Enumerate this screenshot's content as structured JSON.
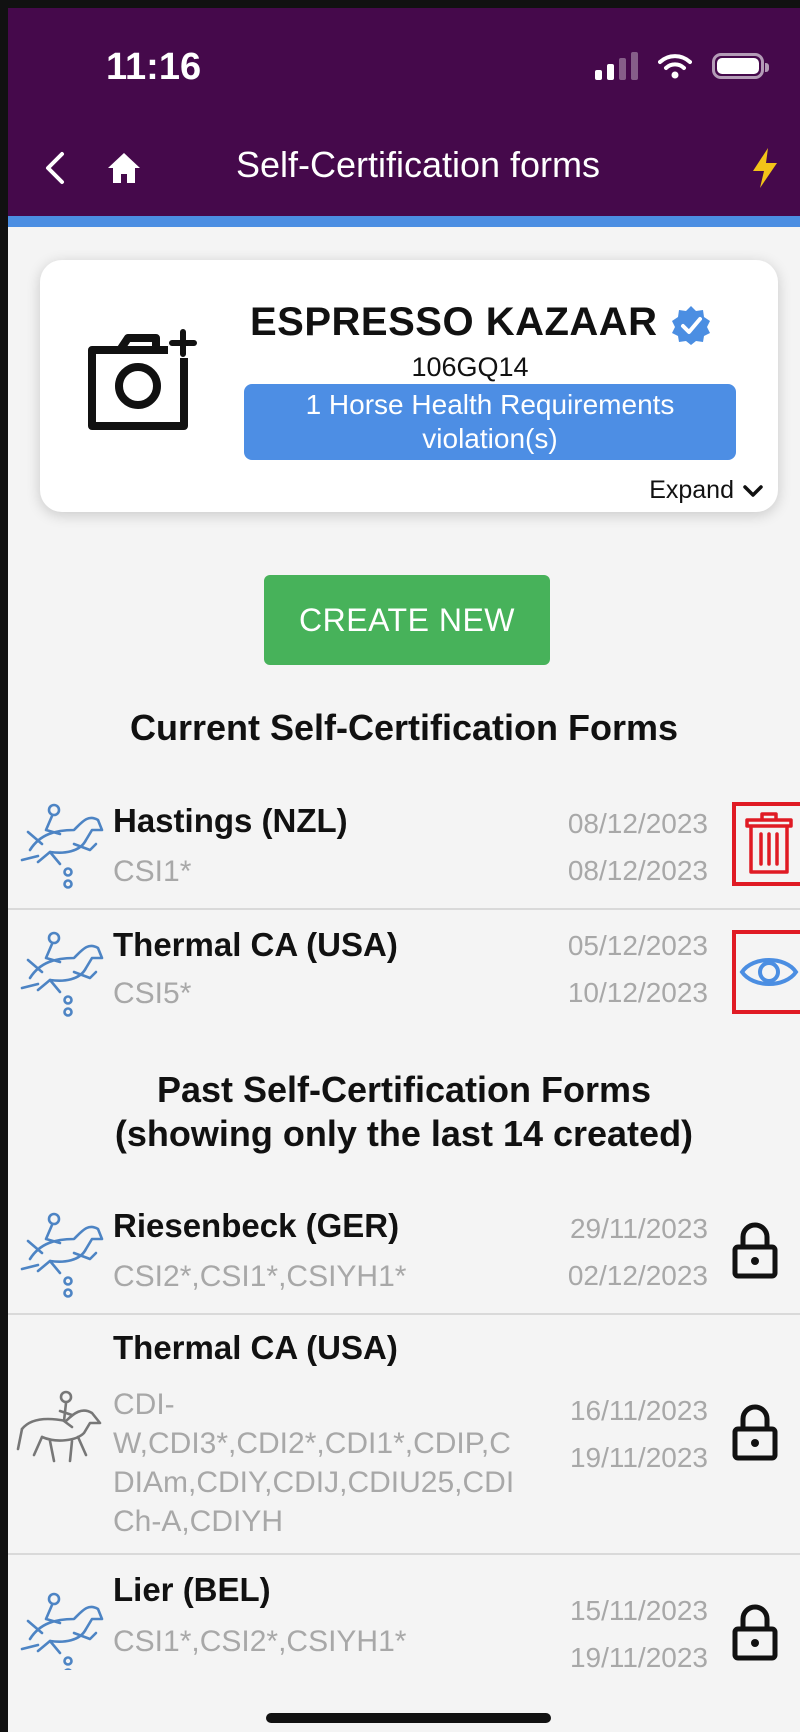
{
  "status_bar": {
    "time": "11:16"
  },
  "nav": {
    "title": "Self-Certification forms"
  },
  "horse": {
    "name": "ESPRESSO KAZAAR",
    "id": "106GQ14",
    "violation": "1 Horse Health Requirements violation(s)",
    "expand_label": "Expand"
  },
  "create_button": "CREATE NEW",
  "current_section": {
    "title": "Current Self-Certification Forms",
    "items": [
      {
        "venue": "Hastings (NZL)",
        "category": "CSI1*",
        "date_start": "08/12/2023",
        "date_end": "08/12/2023",
        "discipline_icon": "jumping-icon",
        "action": "delete"
      },
      {
        "venue": "Thermal CA (USA)",
        "category": "CSI5*",
        "date_start": "05/12/2023",
        "date_end": "10/12/2023",
        "discipline_icon": "jumping-icon",
        "action": "view"
      }
    ]
  },
  "past_section": {
    "title_line1": "Past Self-Certification Forms",
    "title_line2": "(showing only the last 14 created)",
    "items": [
      {
        "venue": "Riesenbeck (GER)",
        "category": "CSI2*,CSI1*,CSIYH1*",
        "date_start": "29/11/2023",
        "date_end": "02/12/2023",
        "discipline_icon": "jumping-icon",
        "action": "locked"
      },
      {
        "venue": "Thermal CA (USA)",
        "category_lines": [
          "CDI-",
          "W,CDI3*,CDI2*,CDI1*,CDIP,C",
          "DIAm,CDIY,CDIJ,CDIU25,CDI",
          "Ch-A,CDIYH"
        ],
        "date_start": "16/11/2023",
        "date_end": "19/11/2023",
        "discipline_icon": "dressage-icon",
        "action": "locked"
      },
      {
        "venue": "Lier (BEL)",
        "category": "CSI1*,CSI2*,CSIYH1*",
        "date_start": "15/11/2023",
        "date_end": "19/11/2023",
        "discipline_icon": "jumping-icon",
        "action": "locked"
      }
    ]
  },
  "colors": {
    "header": "#45094b",
    "accent_blue": "#4b8ee2",
    "create_green": "#47b25a",
    "highlight_red": "#e01b24",
    "bolt_yellow": "#f2c318",
    "muted_text": "#a8a8a8"
  }
}
